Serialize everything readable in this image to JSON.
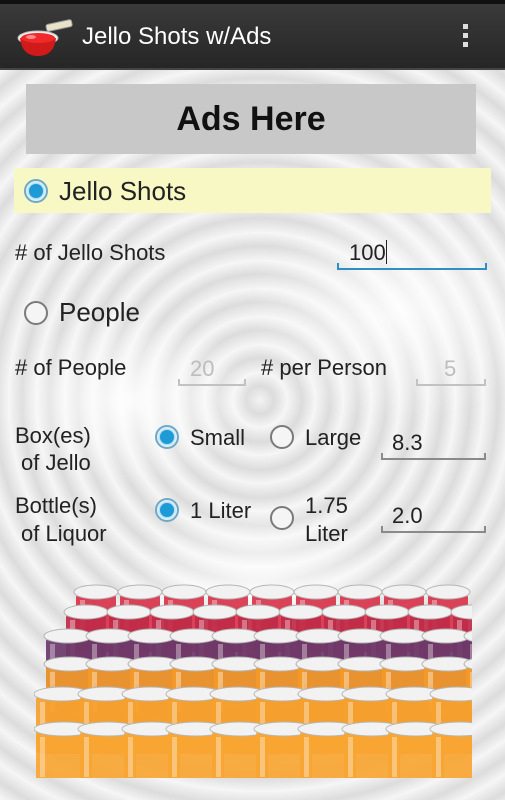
{
  "app": {
    "title": "Jello Shots w/Ads",
    "icon": "jello-cup-icon"
  },
  "ads": {
    "label": "Ads Here"
  },
  "mode": {
    "jello_shots_label": "Jello Shots",
    "jello_shots_selected": true,
    "people_label": "People",
    "people_selected": false
  },
  "jello_shots": {
    "label": "# of Jello Shots",
    "value": "100"
  },
  "people": {
    "count_label": "# of People",
    "count_value": "20",
    "per_person_label": "# per Person",
    "per_person_value": "5"
  },
  "boxes": {
    "label_line1": "Box(es)",
    "label_line2": "of Jello",
    "small_label": "Small",
    "large_label": "Large",
    "selected": "small",
    "result": "8.3"
  },
  "bottles": {
    "label_line1": "Bottle(s)",
    "label_line2": "of Liquor",
    "one_liter_label": "1 Liter",
    "large_label_line1": "1.75",
    "large_label_line2": "Liter",
    "selected": "1 Liter",
    "result": "2.0"
  },
  "colors": {
    "accent": "#1e9bd6",
    "highlight": "#f8f8c4",
    "actionbar": "#2e2e2e"
  }
}
